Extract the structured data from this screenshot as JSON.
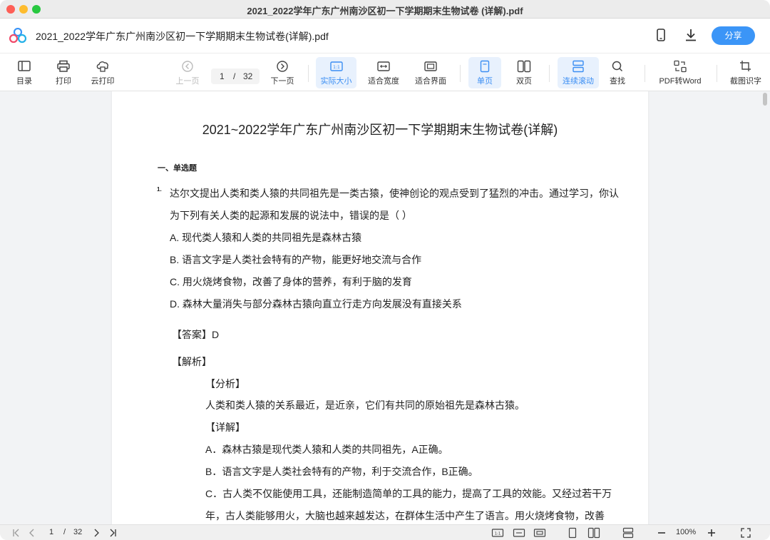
{
  "window": {
    "title": "2021_2022学年广东广州南沙区初一下学期期末生物试卷 (详解).pdf"
  },
  "header": {
    "doc_title": "2021_2022学年广东广州南沙区初一下学期期末生物试卷(详解).pdf",
    "share_label": "分享"
  },
  "toolbar": {
    "toc": "目录",
    "print": "打印",
    "cloud_print": "云打印",
    "prev": "上一页",
    "page_current": "1",
    "page_separator": "/",
    "page_total": "32",
    "next": "下一页",
    "actual_size": "实际大小",
    "fit_width": "适合宽度",
    "fit_page": "适合界面",
    "single_page": "单页",
    "double_page": "双页",
    "continuous": "连续滚动",
    "find": "查找",
    "pdf_to_word": "PDF转Word",
    "ocr": "截图识字"
  },
  "document": {
    "title": "2021~2022学年广东广州南沙区初一下学期期末生物试卷(详解)",
    "section": "一、单选题",
    "question_number": "1.",
    "question_line1": "达尔文提出人类和类人猿的共同祖先是一类古猿，使神创论的观点受到了猛烈的冲击。通过学习，你认",
    "question_line2": "为下列有关人类的起源和发展的说法中，错误的是（        ）",
    "options": [
      "A. 现代类人猿和人类的共同祖先是森林古猿",
      "B. 语言文字是人类社会特有的产物，能更好地交流与合作",
      "C. 用火烧烤食物，改善了身体的营养，有利于脑的发育",
      "D. 森林大量消失与部分森林古猿向直立行走方向发展没有直接关系"
    ],
    "answer_label": "【答案】",
    "answer_value": "D",
    "analysis_label": "【解析】",
    "analysis_sub": "【分析】",
    "analysis_text": "人类和类人猿的关系最近，是近亲，它们有共同的原始祖先是森林古猿。",
    "detail_label": "【详解】",
    "detail_lines": [
      "A．森林古猿是现代类人猿和人类的共同祖先，A正确。",
      "B．语言文字是人类社会特有的产物，利于交流合作，B正确。",
      "C．古人类不仅能使用工具，还能制造简单的工具的能力，提高了工具的效能。又经过若干万",
      "年，古人类能够用火，大脑也越来越发达，在群体生活中产生了语言。用火烧烤食物，改善"
    ]
  },
  "bottombar": {
    "page_current": "1",
    "page_separator": "/",
    "page_total": "32",
    "zoom": "100%"
  },
  "colors": {
    "accent": "#3b95f7",
    "active_bg": "#e8f1fd"
  }
}
